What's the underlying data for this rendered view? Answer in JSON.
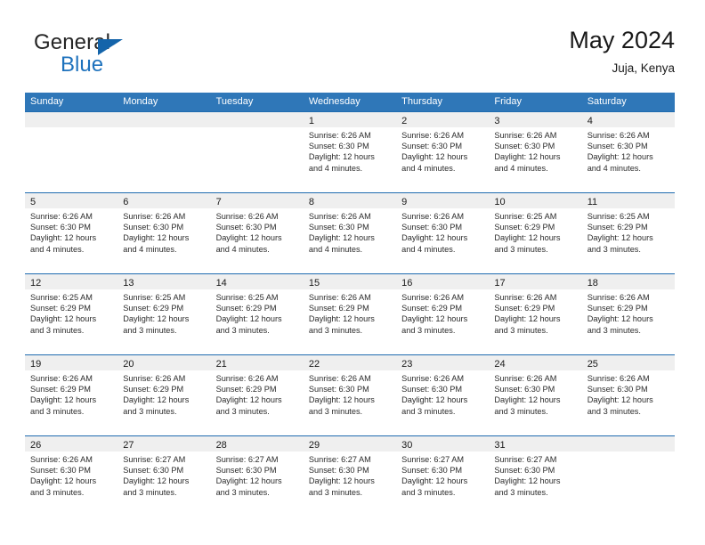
{
  "brand": {
    "name_top": "General",
    "name_bottom": "Blue",
    "triangle_icon": "brand-triangle-icon",
    "colors": {
      "blue": "#1e72bd",
      "triangle": "#1464aa",
      "dark": "#252525"
    }
  },
  "header": {
    "title": "May 2024",
    "subtitle": "Juja, Kenya"
  },
  "calendar": {
    "header_bg": "#2f77b8",
    "row_border": "#1f6bb0",
    "day_band_bg": "#efefef",
    "weekdays": [
      "Sunday",
      "Monday",
      "Tuesday",
      "Wednesday",
      "Thursday",
      "Friday",
      "Saturday"
    ],
    "weeks": [
      [
        {
          "day": "",
          "lines": []
        },
        {
          "day": "",
          "lines": []
        },
        {
          "day": "",
          "lines": []
        },
        {
          "day": "1",
          "lines": [
            "Sunrise: 6:26 AM",
            "Sunset: 6:30 PM",
            "Daylight: 12 hours",
            "and 4 minutes."
          ]
        },
        {
          "day": "2",
          "lines": [
            "Sunrise: 6:26 AM",
            "Sunset: 6:30 PM",
            "Daylight: 12 hours",
            "and 4 minutes."
          ]
        },
        {
          "day": "3",
          "lines": [
            "Sunrise: 6:26 AM",
            "Sunset: 6:30 PM",
            "Daylight: 12 hours",
            "and 4 minutes."
          ]
        },
        {
          "day": "4",
          "lines": [
            "Sunrise: 6:26 AM",
            "Sunset: 6:30 PM",
            "Daylight: 12 hours",
            "and 4 minutes."
          ]
        }
      ],
      [
        {
          "day": "5",
          "lines": [
            "Sunrise: 6:26 AM",
            "Sunset: 6:30 PM",
            "Daylight: 12 hours",
            "and 4 minutes."
          ]
        },
        {
          "day": "6",
          "lines": [
            "Sunrise: 6:26 AM",
            "Sunset: 6:30 PM",
            "Daylight: 12 hours",
            "and 4 minutes."
          ]
        },
        {
          "day": "7",
          "lines": [
            "Sunrise: 6:26 AM",
            "Sunset: 6:30 PM",
            "Daylight: 12 hours",
            "and 4 minutes."
          ]
        },
        {
          "day": "8",
          "lines": [
            "Sunrise: 6:26 AM",
            "Sunset: 6:30 PM",
            "Daylight: 12 hours",
            "and 4 minutes."
          ]
        },
        {
          "day": "9",
          "lines": [
            "Sunrise: 6:26 AM",
            "Sunset: 6:30 PM",
            "Daylight: 12 hours",
            "and 4 minutes."
          ]
        },
        {
          "day": "10",
          "lines": [
            "Sunrise: 6:25 AM",
            "Sunset: 6:29 PM",
            "Daylight: 12 hours",
            "and 3 minutes."
          ]
        },
        {
          "day": "11",
          "lines": [
            "Sunrise: 6:25 AM",
            "Sunset: 6:29 PM",
            "Daylight: 12 hours",
            "and 3 minutes."
          ]
        }
      ],
      [
        {
          "day": "12",
          "lines": [
            "Sunrise: 6:25 AM",
            "Sunset: 6:29 PM",
            "Daylight: 12 hours",
            "and 3 minutes."
          ]
        },
        {
          "day": "13",
          "lines": [
            "Sunrise: 6:25 AM",
            "Sunset: 6:29 PM",
            "Daylight: 12 hours",
            "and 3 minutes."
          ]
        },
        {
          "day": "14",
          "lines": [
            "Sunrise: 6:25 AM",
            "Sunset: 6:29 PM",
            "Daylight: 12 hours",
            "and 3 minutes."
          ]
        },
        {
          "day": "15",
          "lines": [
            "Sunrise: 6:26 AM",
            "Sunset: 6:29 PM",
            "Daylight: 12 hours",
            "and 3 minutes."
          ]
        },
        {
          "day": "16",
          "lines": [
            "Sunrise: 6:26 AM",
            "Sunset: 6:29 PM",
            "Daylight: 12 hours",
            "and 3 minutes."
          ]
        },
        {
          "day": "17",
          "lines": [
            "Sunrise: 6:26 AM",
            "Sunset: 6:29 PM",
            "Daylight: 12 hours",
            "and 3 minutes."
          ]
        },
        {
          "day": "18",
          "lines": [
            "Sunrise: 6:26 AM",
            "Sunset: 6:29 PM",
            "Daylight: 12 hours",
            "and 3 minutes."
          ]
        }
      ],
      [
        {
          "day": "19",
          "lines": [
            "Sunrise: 6:26 AM",
            "Sunset: 6:29 PM",
            "Daylight: 12 hours",
            "and 3 minutes."
          ]
        },
        {
          "day": "20",
          "lines": [
            "Sunrise: 6:26 AM",
            "Sunset: 6:29 PM",
            "Daylight: 12 hours",
            "and 3 minutes."
          ]
        },
        {
          "day": "21",
          "lines": [
            "Sunrise: 6:26 AM",
            "Sunset: 6:29 PM",
            "Daylight: 12 hours",
            "and 3 minutes."
          ]
        },
        {
          "day": "22",
          "lines": [
            "Sunrise: 6:26 AM",
            "Sunset: 6:30 PM",
            "Daylight: 12 hours",
            "and 3 minutes."
          ]
        },
        {
          "day": "23",
          "lines": [
            "Sunrise: 6:26 AM",
            "Sunset: 6:30 PM",
            "Daylight: 12 hours",
            "and 3 minutes."
          ]
        },
        {
          "day": "24",
          "lines": [
            "Sunrise: 6:26 AM",
            "Sunset: 6:30 PM",
            "Daylight: 12 hours",
            "and 3 minutes."
          ]
        },
        {
          "day": "25",
          "lines": [
            "Sunrise: 6:26 AM",
            "Sunset: 6:30 PM",
            "Daylight: 12 hours",
            "and 3 minutes."
          ]
        }
      ],
      [
        {
          "day": "26",
          "lines": [
            "Sunrise: 6:26 AM",
            "Sunset: 6:30 PM",
            "Daylight: 12 hours",
            "and 3 minutes."
          ]
        },
        {
          "day": "27",
          "lines": [
            "Sunrise: 6:27 AM",
            "Sunset: 6:30 PM",
            "Daylight: 12 hours",
            "and 3 minutes."
          ]
        },
        {
          "day": "28",
          "lines": [
            "Sunrise: 6:27 AM",
            "Sunset: 6:30 PM",
            "Daylight: 12 hours",
            "and 3 minutes."
          ]
        },
        {
          "day": "29",
          "lines": [
            "Sunrise: 6:27 AM",
            "Sunset: 6:30 PM",
            "Daylight: 12 hours",
            "and 3 minutes."
          ]
        },
        {
          "day": "30",
          "lines": [
            "Sunrise: 6:27 AM",
            "Sunset: 6:30 PM",
            "Daylight: 12 hours",
            "and 3 minutes."
          ]
        },
        {
          "day": "31",
          "lines": [
            "Sunrise: 6:27 AM",
            "Sunset: 6:30 PM",
            "Daylight: 12 hours",
            "and 3 minutes."
          ]
        },
        {
          "day": "",
          "lines": []
        }
      ]
    ]
  }
}
